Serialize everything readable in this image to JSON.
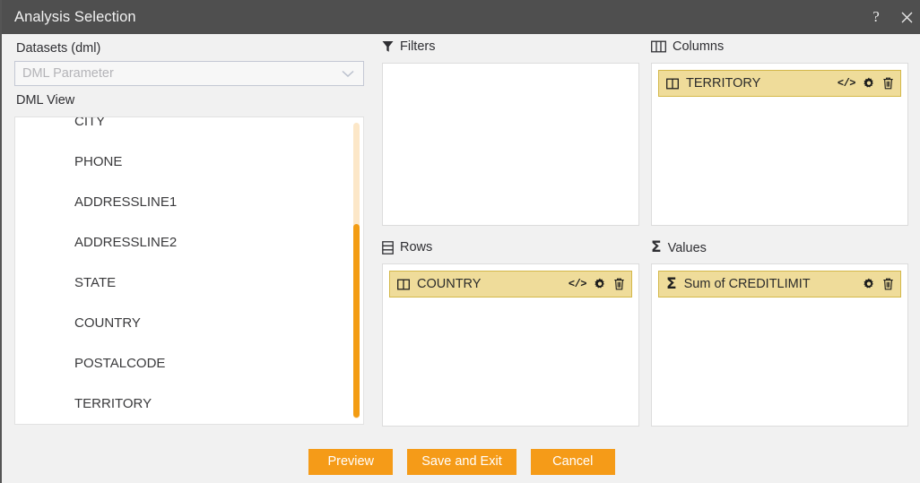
{
  "window": {
    "title": "Analysis Selection",
    "help_icon": "help-icon",
    "help_glyph": "?",
    "close_icon": "close-icon",
    "accent_color": "#f59b18",
    "titlebar_color": "#4f4f4f",
    "chip_fill": "#efdc9a",
    "chip_border": "#d4b849",
    "scroll_track": "#fce7c8",
    "scroll_thumb": "#f39c12"
  },
  "datasets": {
    "label": "Datasets (dml)",
    "select_value": "DML Parameter",
    "select_placeholder": "DML Parameter",
    "chevron_icon": "chevron-down-icon"
  },
  "dml_view": {
    "label": "DML View",
    "fields": [
      "CITY",
      "PHONE",
      "ADDRESSLINE1",
      "ADDRESSLINE2",
      "STATE",
      "COUNTRY",
      "POSTALCODE",
      "TERRITORY"
    ]
  },
  "panels": {
    "filters": {
      "title": "Filters",
      "icon": "funnel-icon",
      "chips": []
    },
    "columns": {
      "title": "Columns",
      "icon": "columns-icon",
      "chips": [
        {
          "label": "TERRITORY",
          "icon": "column-field-icon",
          "actions": [
            "code-icon",
            "gear-icon",
            "trash-icon"
          ],
          "code_glyph": "</>"
        }
      ]
    },
    "rows": {
      "title": "Rows",
      "icon": "rows-icon",
      "chips": [
        {
          "label": "COUNTRY",
          "icon": "column-field-icon",
          "actions": [
            "code-icon",
            "gear-icon",
            "trash-icon"
          ],
          "code_glyph": "</>"
        }
      ]
    },
    "values": {
      "title": "Values",
      "icon": "sigma-icon",
      "sigma_glyph": "Σ",
      "chips": [
        {
          "label": "Sum of CREDITLIMIT",
          "icon": "sigma-icon",
          "actions": [
            "gear-icon",
            "trash-icon"
          ]
        }
      ]
    }
  },
  "footer": {
    "preview_label": "Preview",
    "save_label": "Save and Exit",
    "cancel_label": "Cancel"
  }
}
